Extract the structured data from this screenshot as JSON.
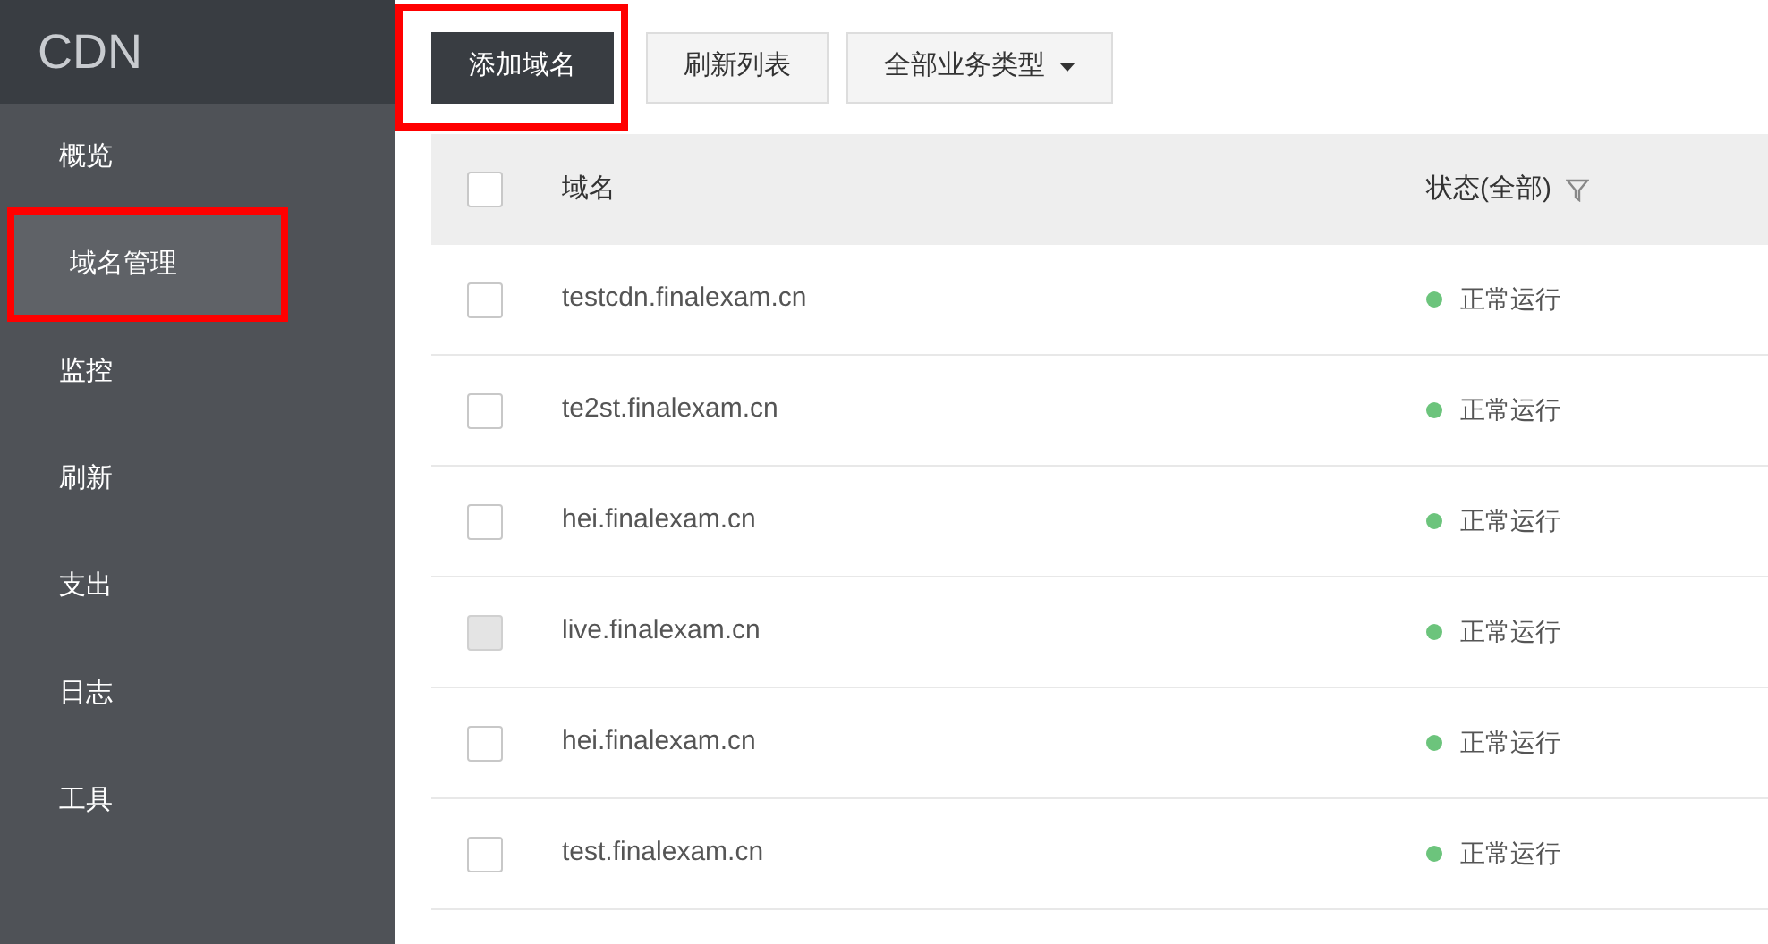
{
  "sidebar": {
    "title": "CDN",
    "items": [
      {
        "label": "概览",
        "selected": false,
        "highlighted": false
      },
      {
        "label": "域名管理",
        "selected": true,
        "highlighted": true
      },
      {
        "label": "监控",
        "selected": false,
        "highlighted": false
      },
      {
        "label": "刷新",
        "selected": false,
        "highlighted": false
      },
      {
        "label": "支出",
        "selected": false,
        "highlighted": false
      },
      {
        "label": "日志",
        "selected": false,
        "highlighted": false
      },
      {
        "label": "工具",
        "selected": false,
        "highlighted": false
      }
    ]
  },
  "toolbar": {
    "buttons": [
      {
        "label": "添加域名",
        "kind": "primary",
        "highlighted": true
      },
      {
        "label": "刷新列表",
        "kind": "default",
        "highlighted": false
      },
      {
        "label": "全部业务类型",
        "kind": "dropdown",
        "highlighted": false
      }
    ]
  },
  "table": {
    "columns": [
      "域名",
      "状态(全部)"
    ],
    "header_checked": false,
    "rows": [
      {
        "domain": "testcdn.finalexam.cn",
        "status": "正常运行",
        "color": "#6cc47c",
        "checked": false,
        "disabled": false
      },
      {
        "domain": "te2st.finalexam.cn",
        "status": "正常运行",
        "color": "#6cc47c",
        "checked": false,
        "disabled": false
      },
      {
        "domain": "hei.finalexam.cn",
        "status": "正常运行",
        "color": "#6cc47c",
        "checked": false,
        "disabled": false
      },
      {
        "domain": "live.finalexam.cn",
        "status": "正常运行",
        "color": "#6cc47c",
        "checked": false,
        "disabled": true
      },
      {
        "domain": "hei.finalexam.cn",
        "status": "正常运行",
        "color": "#6cc47c",
        "checked": false,
        "disabled": false
      },
      {
        "domain": "test.finalexam.cn",
        "status": "正常运行",
        "color": "#6cc47c",
        "checked": false,
        "disabled": false
      }
    ]
  }
}
